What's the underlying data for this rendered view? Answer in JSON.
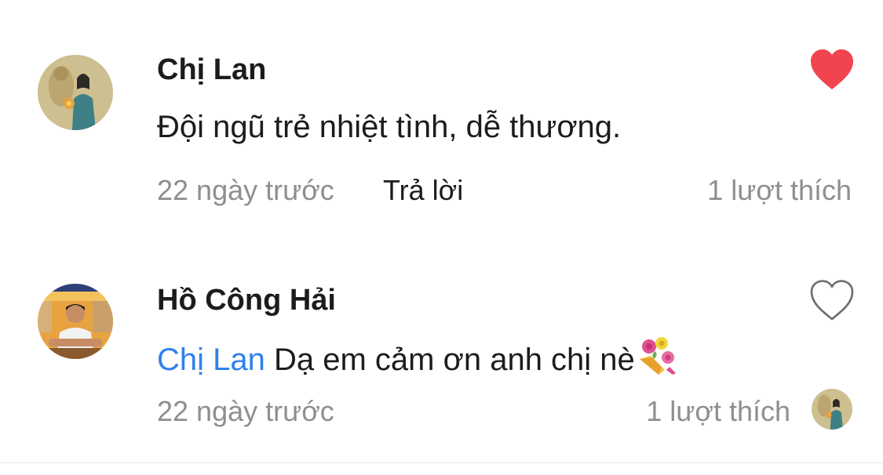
{
  "comments": [
    {
      "author": "Chị Lan",
      "text": "Đội ngũ trẻ nhiệt tình, dễ thương.",
      "time": "22 ngày trước",
      "reply_label": "Trả lời",
      "likes": "1 lượt thích",
      "liked": true
    },
    {
      "author": "Hồ Công Hải",
      "mention": "Chị Lan",
      "text": "Dạ em cảm ơn anh chị nè",
      "emoji": "bouquet-icon",
      "time": "22 ngày trước",
      "likes": "1 lượt thích",
      "liked": false
    }
  ],
  "colors": {
    "heart_liked": "#f2444f",
    "mention": "#2f80ed",
    "meta": "#8e8e93",
    "text": "#1c1c1e"
  }
}
